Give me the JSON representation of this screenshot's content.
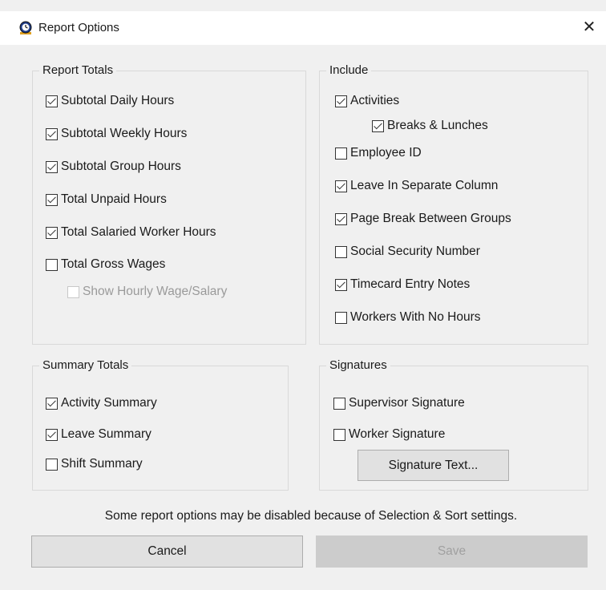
{
  "window": {
    "title": "Report Options",
    "close_glyph": "✕",
    "app_icon": "clock-globe-icon"
  },
  "report_totals": {
    "title": "Report Totals",
    "items": [
      {
        "label": "Subtotal Daily Hours",
        "checked": true
      },
      {
        "label": "Subtotal Weekly Hours",
        "checked": true
      },
      {
        "label": "Subtotal Group Hours",
        "checked": true
      },
      {
        "label": "Total Unpaid Hours",
        "checked": true
      },
      {
        "label": "Total Salaried Worker Hours",
        "checked": true
      },
      {
        "label": "Total Gross Wages",
        "checked": false
      },
      {
        "label": "Show Hourly Wage/Salary",
        "checked": false,
        "disabled": true
      }
    ]
  },
  "include": {
    "title": "Include",
    "items": [
      {
        "label": "Activities",
        "checked": true
      },
      {
        "label": "Breaks & Lunches",
        "checked": true
      },
      {
        "label": "Employee ID",
        "checked": false
      },
      {
        "label": "Leave In Separate Column",
        "checked": true
      },
      {
        "label": "Page Break Between Groups",
        "checked": true
      },
      {
        "label": "Social Security Number",
        "checked": false
      },
      {
        "label": "Timecard Entry Notes",
        "checked": true
      },
      {
        "label": "Workers With No Hours",
        "checked": false
      }
    ]
  },
  "summary_totals": {
    "title": "Summary Totals",
    "items": [
      {
        "label": "Activity Summary",
        "checked": true
      },
      {
        "label": "Leave Summary",
        "checked": true
      },
      {
        "label": "Shift Summary",
        "checked": false
      }
    ]
  },
  "signatures": {
    "title": "Signatures",
    "items": [
      {
        "label": "Supervisor Signature",
        "checked": false
      },
      {
        "label": "Worker Signature",
        "checked": false
      }
    ],
    "button_label": "Signature Text..."
  },
  "notice": "Some report options may be disabled because of Selection & Sort settings.",
  "buttons": {
    "cancel": "Cancel",
    "save": "Save"
  }
}
